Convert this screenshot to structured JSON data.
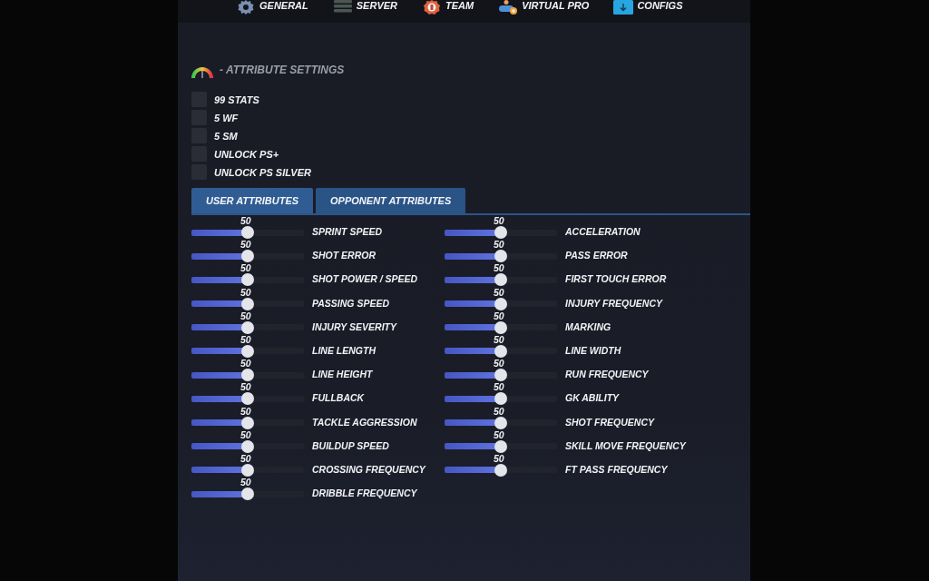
{
  "nav": {
    "items": [
      {
        "label": "GENERAL",
        "kind": "gear"
      },
      {
        "label": "SERVER",
        "kind": "server"
      },
      {
        "label": "TEAM",
        "kind": "badge"
      },
      {
        "label": "VIRTUAL PRO",
        "kind": "person"
      },
      {
        "label": "CONFIGS",
        "kind": "download"
      }
    ]
  },
  "section": {
    "title": "- ATTRIBUTE SETTINGS"
  },
  "options": [
    {
      "label": "99 STATS",
      "checked": false
    },
    {
      "label": "5 WF",
      "checked": false
    },
    {
      "label": "5 SM",
      "checked": false
    },
    {
      "label": "UNLOCK PS+",
      "checked": false
    },
    {
      "label": "UNLOCK PS SILVER",
      "checked": false
    }
  ],
  "tabs": [
    {
      "label": "USER ATTRIBUTES",
      "selected": true
    },
    {
      "label": "OPPONENT ATTRIBUTES",
      "selected": false
    }
  ],
  "columns": [
    {
      "sliders": [
        {
          "label": "SPRINT SPEED",
          "value": "50",
          "level": 0.5
        },
        {
          "label": "SHOT ERROR",
          "value": "50",
          "level": 0.5
        },
        {
          "label": "SHOT POWER / SPEED",
          "value": "50",
          "level": 0.5
        },
        {
          "label": "PASSING SPEED",
          "value": "50",
          "level": 0.5
        },
        {
          "label": "INJURY SEVERITY",
          "value": "50",
          "level": 0.5
        },
        {
          "label": "LINE LENGTH",
          "value": "50",
          "level": 0.5
        },
        {
          "label": "LINE HEIGHT",
          "value": "50",
          "level": 0.5
        },
        {
          "label": "FULLBACK",
          "value": "50",
          "level": 0.5
        },
        {
          "label": "TACKLE AGGRESSION",
          "value": "50",
          "level": 0.5
        },
        {
          "label": "BUILDUP SPEED",
          "value": "50",
          "level": 0.5
        },
        {
          "label": "CROSSING FREQUENCY",
          "value": "50",
          "level": 0.5
        },
        {
          "label": "DRIBBLE FREQUENCY",
          "value": "50",
          "level": 0.5
        }
      ]
    },
    {
      "sliders": [
        {
          "label": "ACCELERATION",
          "value": "50",
          "level": 0.5
        },
        {
          "label": "PASS ERROR",
          "value": "50",
          "level": 0.5
        },
        {
          "label": "FIRST TOUCH ERROR",
          "value": "50",
          "level": 0.5
        },
        {
          "label": "INJURY FREQUENCY",
          "value": "50",
          "level": 0.5
        },
        {
          "label": "MARKING",
          "value": "50",
          "level": 0.5
        },
        {
          "label": "LINE WIDTH",
          "value": "50",
          "level": 0.5
        },
        {
          "label": "RUN FREQUENCY",
          "value": "50",
          "level": 0.5
        },
        {
          "label": "GK ABILITY",
          "value": "50",
          "level": 0.5
        },
        {
          "label": "SHOT FREQUENCY",
          "value": "50",
          "level": 0.5
        },
        {
          "label": "SKILL MOVE FREQUENCY",
          "value": "50",
          "level": 0.5
        },
        {
          "label": "FT PASS FREQUENCY",
          "value": "50",
          "level": 0.5
        }
      ]
    }
  ]
}
